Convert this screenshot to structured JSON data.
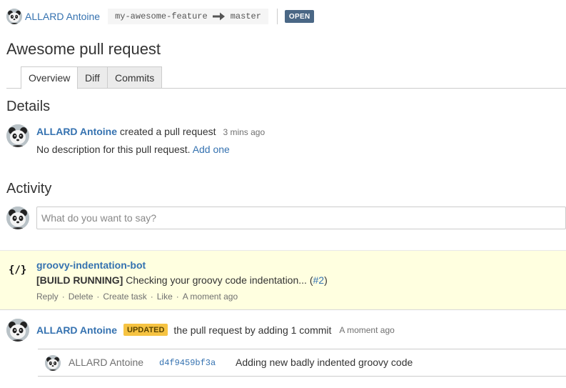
{
  "header": {
    "author": "ALLARD Antoine",
    "source_branch": "my-awesome-feature",
    "target_branch": "master",
    "state": "OPEN"
  },
  "title": "Awesome pull request",
  "tabs": [
    {
      "label": "Overview",
      "active": true
    },
    {
      "label": "Diff",
      "active": false
    },
    {
      "label": "Commits",
      "active": false
    }
  ],
  "details": {
    "heading": "Details",
    "author": "ALLARD Antoine",
    "action": "created a pull request",
    "time": "3 mins ago",
    "description": "No description for this pull request.",
    "add_link": "Add one"
  },
  "activity": {
    "heading": "Activity",
    "comment_placeholder": "What do you want to say?",
    "bot_comment": {
      "icon": "{/}",
      "author": "groovy-indentation-bot",
      "status": "[BUILD RUNNING]",
      "text": "Checking your groovy code indentation...",
      "link_open": "(",
      "link": "#2",
      "link_close": ")",
      "actions": {
        "reply": "Reply",
        "delete": "Delete",
        "create_task": "Create task",
        "like": "Like",
        "time": "A moment ago"
      }
    },
    "update": {
      "author": "ALLARD Antoine",
      "badge": "UPDATED",
      "text": "the pull request by adding 1 commit",
      "time": "A moment ago",
      "commit": {
        "author": "ALLARD Antoine",
        "hash": "d4f9459bf3a",
        "message": "Adding new badly indented groovy code"
      }
    }
  },
  "colors": {
    "link": "#3572b0",
    "open_badge": "#4a6785",
    "updated_badge": "#f6c342",
    "bot_background": "#ffffe0"
  }
}
